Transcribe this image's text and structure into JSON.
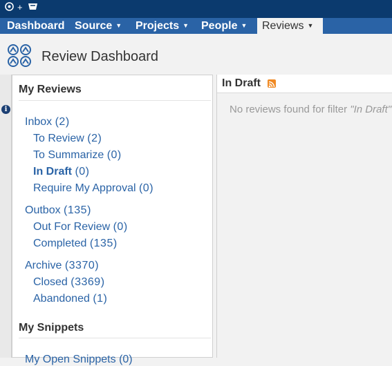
{
  "topbar": {
    "icons": [
      "bamboo-icon",
      "plus-icon",
      "crucible-icon"
    ],
    "plus_glyph": "+"
  },
  "nav": {
    "items": [
      {
        "label": "Dashboard",
        "dropdown": false
      },
      {
        "label": "Source",
        "dropdown": true
      },
      {
        "label": "Projects",
        "dropdown": true
      },
      {
        "label": "People",
        "dropdown": true
      },
      {
        "label": "Reviews",
        "dropdown": true,
        "active": true
      }
    ],
    "caret": "▼"
  },
  "page": {
    "title": "Review Dashboard"
  },
  "sidebar": {
    "my_reviews_heading": "My Reviews",
    "groups": [
      {
        "label": "Inbox",
        "count": "(2)",
        "children": [
          {
            "label": "To Review",
            "count": "(2)"
          },
          {
            "label": "To Summarize",
            "count": "(0)"
          },
          {
            "label": "In Draft",
            "count": "(0)",
            "selected": true
          },
          {
            "label": "Require My Approval",
            "count": "(0)"
          }
        ]
      },
      {
        "label": "Outbox",
        "count": "(135)",
        "children": [
          {
            "label": "Out For Review",
            "count": "(0)"
          },
          {
            "label": "Completed",
            "count": "(135)"
          }
        ]
      },
      {
        "label": "Archive",
        "count": "(3370)",
        "children": [
          {
            "label": "Closed",
            "count": "(3369)"
          },
          {
            "label": "Abandoned",
            "count": "(1)"
          }
        ]
      }
    ],
    "my_snippets_heading": "My Snippets",
    "snippets_partial": "My Open Snippets (0)"
  },
  "main": {
    "title": "In Draft",
    "empty_prefix": "No reviews found for filter ",
    "empty_filter": "\"In Draft\""
  },
  "colors": {
    "topstrip": "#0b3a6e",
    "navbar": "#2a63a6",
    "link": "#2a63a6",
    "rss": "#f08a24"
  }
}
